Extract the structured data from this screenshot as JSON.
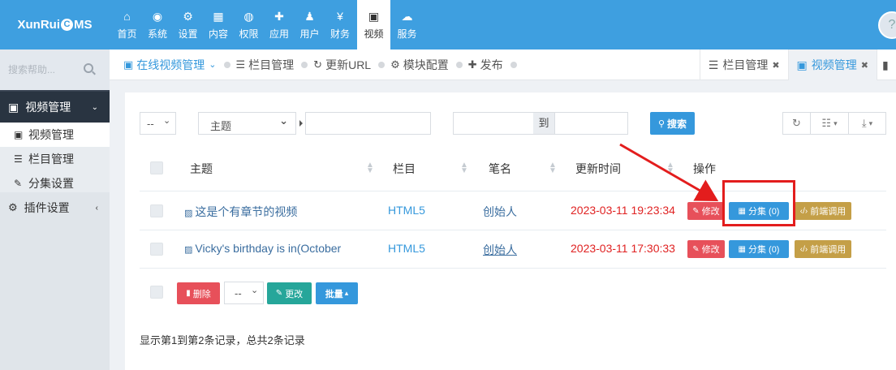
{
  "app": {
    "logo": "XunRuiCMS",
    "logo_left": "XunRui",
    "logo_c": "C",
    "logo_right": "MS"
  },
  "nav": [
    {
      "label": "首页",
      "icon": "home-icon",
      "glyph": "⌂"
    },
    {
      "label": "系统",
      "icon": "globe-icon",
      "glyph": "◉"
    },
    {
      "label": "设置",
      "icon": "cogs-icon",
      "glyph": "⚙"
    },
    {
      "label": "内容",
      "icon": "grid-icon",
      "glyph": "▦"
    },
    {
      "label": "权限",
      "icon": "user-circle-icon",
      "glyph": "◍"
    },
    {
      "label": "应用",
      "icon": "puzzle-icon",
      "glyph": "✚"
    },
    {
      "label": "用户",
      "icon": "user-icon",
      "glyph": "♟"
    },
    {
      "label": "财务",
      "icon": "yen-icon",
      "glyph": "¥"
    },
    {
      "label": "视频",
      "icon": "video-file-icon",
      "glyph": "▣",
      "active": true
    },
    {
      "label": "服务",
      "icon": "cloud-icon",
      "glyph": "☁"
    }
  ],
  "sidebar": {
    "search_placeholder": "搜索帮助...",
    "section_open": "视频管理",
    "items": [
      {
        "label": "视频管理",
        "icon": "video-icon",
        "active": true
      },
      {
        "label": "栏目管理",
        "icon": "list-icon"
      },
      {
        "label": "分集设置",
        "icon": "edit-icon"
      }
    ],
    "section_plugin": "插件设置"
  },
  "breadcrumb": {
    "items": [
      "在线视频管理",
      "栏目管理",
      "更新URL",
      "模块配置",
      "发布"
    ],
    "dropdown": "⌄"
  },
  "tabs": [
    {
      "label": "栏目管理",
      "active": false
    },
    {
      "label": "视频管理",
      "active": true
    }
  ],
  "filters": {
    "select_small": "--",
    "select_field": "主题",
    "keyword_value": "",
    "date_sep": "到",
    "search_button": "搜索"
  },
  "table": {
    "headers": [
      "主题",
      "栏目",
      "笔名",
      "更新时间",
      "操作"
    ],
    "rows": [
      {
        "title": "这是个有章节的视频",
        "category": "HTML5",
        "author": "创始人",
        "updated": "2023-03-11 19:23:34"
      },
      {
        "title": "Vicky's birthday is in(October",
        "category": "HTML5",
        "author": "创始人",
        "updated": "2023-03-11 17:30:33"
      }
    ],
    "actions": {
      "edit": "修改",
      "episodes": "分集 (0)",
      "frontend": "前端调用"
    }
  },
  "bulk": {
    "delete": "删除",
    "select": "--",
    "change": "更改",
    "batch": "批量"
  },
  "footer": {
    "summary": "显示第1到第2条记录，总共2条记录"
  },
  "colors": {
    "topbar": "#3e9fe0",
    "sidebar_dark": "#364150",
    "highlight": "#e31d1d",
    "date_red": "#e02222"
  }
}
